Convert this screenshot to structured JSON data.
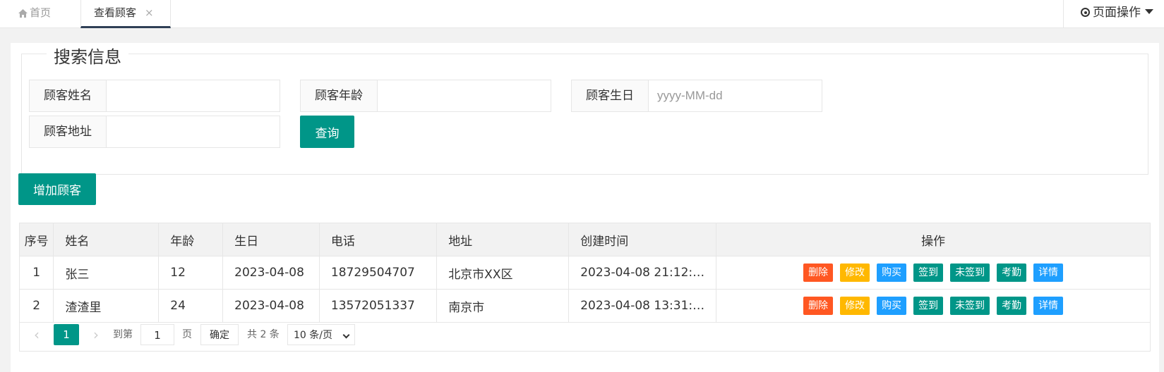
{
  "tabs": {
    "home_label": "首页",
    "active_label": "查看顾客",
    "close_glyph": "×",
    "page_ops_label": "页面操作"
  },
  "search": {
    "legend": "搜索信息",
    "name_label": "顾客姓名",
    "name_value": "",
    "age_label": "顾客年龄",
    "age_value": "",
    "birthday_label": "顾客生日",
    "birthday_placeholder": "yyyy-MM-dd",
    "address_label": "顾客地址",
    "address_value": "",
    "query_label": "查询"
  },
  "add_label": "增加顾客",
  "table": {
    "headers": [
      "序号",
      "姓名",
      "年龄",
      "生日",
      "电话",
      "地址",
      "创建时间",
      "操作"
    ],
    "action_labels": [
      "删除",
      "修改",
      "购买",
      "签到",
      "未签到",
      "考勤",
      "详情"
    ],
    "rows": [
      {
        "idx": "1",
        "name": "张三",
        "age": "12",
        "birthday": "2023-04-08",
        "phone": "18729504707",
        "address": "北京市XX区",
        "created": "2023-04-08 21:12:…"
      },
      {
        "idx": "2",
        "name": "渣渣里",
        "age": "24",
        "birthday": "2023-04-08",
        "phone": "13572051337",
        "address": "南京市",
        "created": "2023-04-08 13:31:…"
      }
    ]
  },
  "pager": {
    "current": "1",
    "goto_label": "到第",
    "goto_value": "1",
    "page_suffix": "页",
    "confirm_label": "确定",
    "total_text": "共 2 条",
    "page_size": "10 条/页"
  },
  "colors": {
    "primary": "#009688",
    "danger": "#ff5722",
    "warn": "#ffb800",
    "info": "#1e9fff"
  }
}
